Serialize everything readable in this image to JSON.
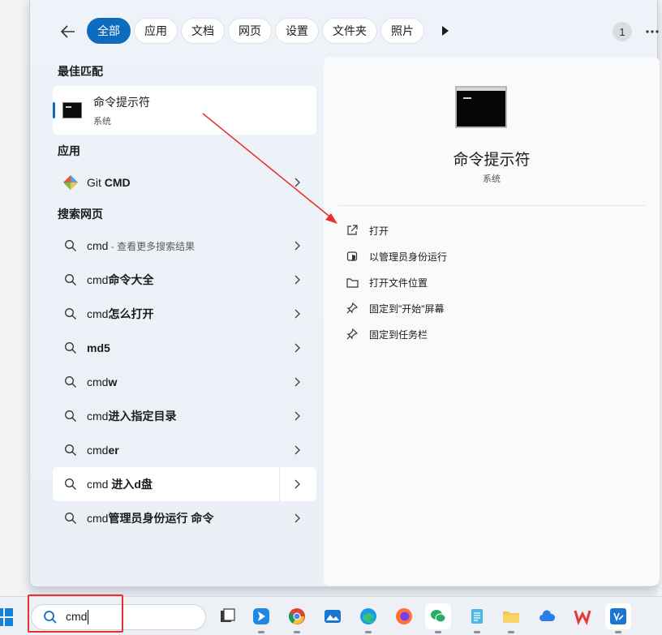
{
  "tabs": [
    "全部",
    "应用",
    "文档",
    "网页",
    "设置",
    "文件夹",
    "照片"
  ],
  "active_tab": "全部",
  "badge_count": "1",
  "sections": {
    "best_match": "最佳匹配",
    "apps": "应用",
    "web": "搜索网页"
  },
  "best_match": {
    "title": "命令提示符",
    "subtitle": "系统"
  },
  "apps": [
    {
      "label_pre": "Git ",
      "label_bold": "CMD"
    }
  ],
  "web_results": [
    {
      "pre": "cmd",
      "bold": "",
      "hint": " - 查看更多搜索结果"
    },
    {
      "pre": "cmd",
      "bold": "命令大全",
      "hint": ""
    },
    {
      "pre": "cmd",
      "bold": "怎么打开",
      "hint": ""
    },
    {
      "pre": "",
      "bold": "md5",
      "hint": ""
    },
    {
      "pre": "cmd",
      "bold": "w",
      "hint": ""
    },
    {
      "pre": "cmd",
      "bold": "进入指定目录",
      "hint": ""
    },
    {
      "pre": "cmd",
      "bold": "er",
      "hint": ""
    },
    {
      "pre": "cmd ",
      "bold": "进入d盘",
      "hint": ""
    },
    {
      "pre": "cmd",
      "bold": "管理员身份运行 命令",
      "hint": ""
    }
  ],
  "preview": {
    "title": "命令提示符",
    "subtitle": "系统",
    "actions": [
      {
        "label": "打开",
        "icon": "open-external-icon"
      },
      {
        "label": "以管理员身份运行",
        "icon": "shield-icon"
      },
      {
        "label": "打开文件位置",
        "icon": "folder-icon"
      },
      {
        "label": "固定到\"开始\"屏幕",
        "icon": "pin-icon"
      },
      {
        "label": "固定到任务栏",
        "icon": "pin-icon"
      }
    ]
  },
  "taskbar": {
    "search_text": "cmd",
    "apps": [
      "task-view-icon",
      "feishu-icon",
      "chrome-icon",
      "photos-icon",
      "edge-icon",
      "firefox-icon",
      "wechat-icon",
      "notepad-icon",
      "file-explorer-icon",
      "cloud-icon",
      "wps-icon",
      "vscode-icon"
    ]
  },
  "colors": {
    "accent": "#0f6cbd",
    "annotation_red": "#e8312f"
  }
}
